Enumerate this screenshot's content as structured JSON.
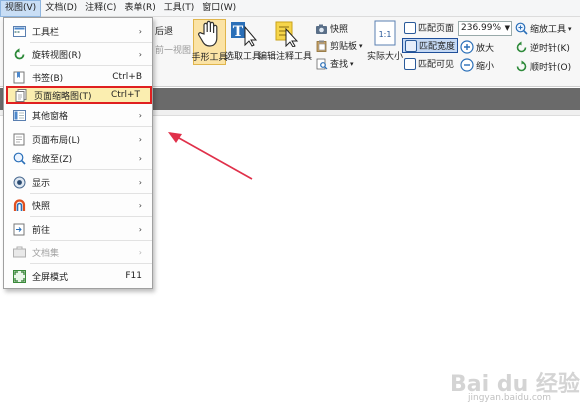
{
  "menubar": {
    "items": [
      "视图(V)",
      "文档(D)",
      "注释(C)",
      "表单(R)",
      "工具(T)",
      "窗口(W)"
    ]
  },
  "ribbon": {
    "back_label": "后退",
    "prev_view_label": "前一视图",
    "hand_tool_label": "手形工具",
    "select_tool_label": "选取工具",
    "edit_annot_tool_label": "编辑注释工具",
    "snapshot_label": "快照",
    "clipboard_label": "剪贴板",
    "find_label": "查找",
    "actual_size_label": "实际大小",
    "actual_size_icon_text": "1:1",
    "fit_page_label": "匹配页面",
    "fit_width_label": "匹配宽度",
    "fit_visible_label": "匹配可见",
    "zoom_value": "236.99%",
    "zoom_in_label": "放大",
    "zoom_out_label": "缩小",
    "zoom_tool_label": "缩放工具",
    "rotate_ccw_label": "逆时针(K)",
    "rotate_cw_label": "顺时针(O)"
  },
  "menu": {
    "items": [
      {
        "label": "工具栏",
        "shortcut": "",
        "arrow": "›"
      },
      {
        "label": "旋转视图(R)",
        "shortcut": "",
        "arrow": "›"
      },
      {
        "label": "书签(B)",
        "shortcut": "Ctrl+B",
        "arrow": ""
      },
      {
        "label": "页面缩略图(T)",
        "shortcut": "Ctrl+T",
        "arrow": ""
      },
      {
        "label": "其他窗格",
        "shortcut": "",
        "arrow": "›"
      },
      {
        "label": "页面布局(L)",
        "shortcut": "",
        "arrow": "›"
      },
      {
        "label": "缩放至(Z)",
        "shortcut": "",
        "arrow": "›"
      },
      {
        "label": "显示",
        "shortcut": "",
        "arrow": "›"
      },
      {
        "label": "快照",
        "shortcut": "",
        "arrow": "›"
      },
      {
        "label": "前往",
        "shortcut": "",
        "arrow": "›"
      },
      {
        "label": "文档集",
        "shortcut": "",
        "arrow": "›"
      },
      {
        "label": "全屏模式",
        "shortcut": "F11",
        "arrow": ""
      }
    ]
  },
  "watermark": {
    "text": "Bai du 经验",
    "sub": "jingyan.baidu.com"
  },
  "colors": {
    "highlight_border": "#e02020",
    "annotation_arrow": "#e0304a",
    "menu_highlight_bg": "#fbeeb0"
  }
}
